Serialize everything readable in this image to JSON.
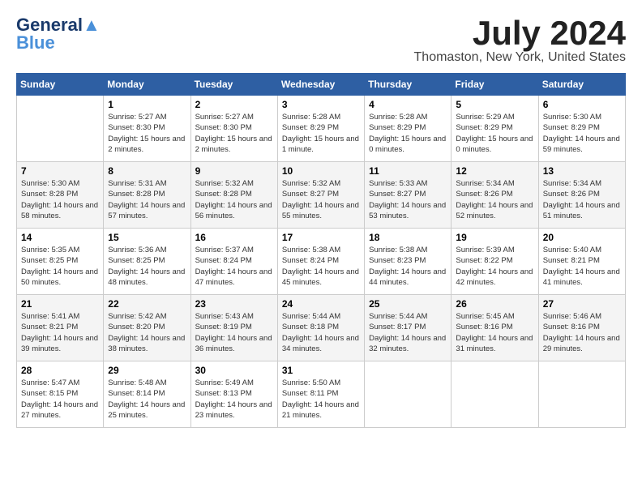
{
  "logo": {
    "line1": "General",
    "line2": "Blue",
    "tagline": ""
  },
  "title": "July 2024",
  "location": "Thomaston, New York, United States",
  "days_of_week": [
    "Sunday",
    "Monday",
    "Tuesday",
    "Wednesday",
    "Thursday",
    "Friday",
    "Saturday"
  ],
  "weeks": [
    [
      {
        "num": "",
        "info": ""
      },
      {
        "num": "1",
        "info": "Sunrise: 5:27 AM\nSunset: 8:30 PM\nDaylight: 15 hours\nand 2 minutes."
      },
      {
        "num": "2",
        "info": "Sunrise: 5:27 AM\nSunset: 8:30 PM\nDaylight: 15 hours\nand 2 minutes."
      },
      {
        "num": "3",
        "info": "Sunrise: 5:28 AM\nSunset: 8:29 PM\nDaylight: 15 hours\nand 1 minute."
      },
      {
        "num": "4",
        "info": "Sunrise: 5:28 AM\nSunset: 8:29 PM\nDaylight: 15 hours\nand 0 minutes."
      },
      {
        "num": "5",
        "info": "Sunrise: 5:29 AM\nSunset: 8:29 PM\nDaylight: 15 hours\nand 0 minutes."
      },
      {
        "num": "6",
        "info": "Sunrise: 5:30 AM\nSunset: 8:29 PM\nDaylight: 14 hours\nand 59 minutes."
      }
    ],
    [
      {
        "num": "7",
        "info": "Sunrise: 5:30 AM\nSunset: 8:28 PM\nDaylight: 14 hours\nand 58 minutes."
      },
      {
        "num": "8",
        "info": "Sunrise: 5:31 AM\nSunset: 8:28 PM\nDaylight: 14 hours\nand 57 minutes."
      },
      {
        "num": "9",
        "info": "Sunrise: 5:32 AM\nSunset: 8:28 PM\nDaylight: 14 hours\nand 56 minutes."
      },
      {
        "num": "10",
        "info": "Sunrise: 5:32 AM\nSunset: 8:27 PM\nDaylight: 14 hours\nand 55 minutes."
      },
      {
        "num": "11",
        "info": "Sunrise: 5:33 AM\nSunset: 8:27 PM\nDaylight: 14 hours\nand 53 minutes."
      },
      {
        "num": "12",
        "info": "Sunrise: 5:34 AM\nSunset: 8:26 PM\nDaylight: 14 hours\nand 52 minutes."
      },
      {
        "num": "13",
        "info": "Sunrise: 5:34 AM\nSunset: 8:26 PM\nDaylight: 14 hours\nand 51 minutes."
      }
    ],
    [
      {
        "num": "14",
        "info": "Sunrise: 5:35 AM\nSunset: 8:25 PM\nDaylight: 14 hours\nand 50 minutes."
      },
      {
        "num": "15",
        "info": "Sunrise: 5:36 AM\nSunset: 8:25 PM\nDaylight: 14 hours\nand 48 minutes."
      },
      {
        "num": "16",
        "info": "Sunrise: 5:37 AM\nSunset: 8:24 PM\nDaylight: 14 hours\nand 47 minutes."
      },
      {
        "num": "17",
        "info": "Sunrise: 5:38 AM\nSunset: 8:24 PM\nDaylight: 14 hours\nand 45 minutes."
      },
      {
        "num": "18",
        "info": "Sunrise: 5:38 AM\nSunset: 8:23 PM\nDaylight: 14 hours\nand 44 minutes."
      },
      {
        "num": "19",
        "info": "Sunrise: 5:39 AM\nSunset: 8:22 PM\nDaylight: 14 hours\nand 42 minutes."
      },
      {
        "num": "20",
        "info": "Sunrise: 5:40 AM\nSunset: 8:21 PM\nDaylight: 14 hours\nand 41 minutes."
      }
    ],
    [
      {
        "num": "21",
        "info": "Sunrise: 5:41 AM\nSunset: 8:21 PM\nDaylight: 14 hours\nand 39 minutes."
      },
      {
        "num": "22",
        "info": "Sunrise: 5:42 AM\nSunset: 8:20 PM\nDaylight: 14 hours\nand 38 minutes."
      },
      {
        "num": "23",
        "info": "Sunrise: 5:43 AM\nSunset: 8:19 PM\nDaylight: 14 hours\nand 36 minutes."
      },
      {
        "num": "24",
        "info": "Sunrise: 5:44 AM\nSunset: 8:18 PM\nDaylight: 14 hours\nand 34 minutes."
      },
      {
        "num": "25",
        "info": "Sunrise: 5:44 AM\nSunset: 8:17 PM\nDaylight: 14 hours\nand 32 minutes."
      },
      {
        "num": "26",
        "info": "Sunrise: 5:45 AM\nSunset: 8:16 PM\nDaylight: 14 hours\nand 31 minutes."
      },
      {
        "num": "27",
        "info": "Sunrise: 5:46 AM\nSunset: 8:16 PM\nDaylight: 14 hours\nand 29 minutes."
      }
    ],
    [
      {
        "num": "28",
        "info": "Sunrise: 5:47 AM\nSunset: 8:15 PM\nDaylight: 14 hours\nand 27 minutes."
      },
      {
        "num": "29",
        "info": "Sunrise: 5:48 AM\nSunset: 8:14 PM\nDaylight: 14 hours\nand 25 minutes."
      },
      {
        "num": "30",
        "info": "Sunrise: 5:49 AM\nSunset: 8:13 PM\nDaylight: 14 hours\nand 23 minutes."
      },
      {
        "num": "31",
        "info": "Sunrise: 5:50 AM\nSunset: 8:11 PM\nDaylight: 14 hours\nand 21 minutes."
      },
      {
        "num": "",
        "info": ""
      },
      {
        "num": "",
        "info": ""
      },
      {
        "num": "",
        "info": ""
      }
    ]
  ]
}
